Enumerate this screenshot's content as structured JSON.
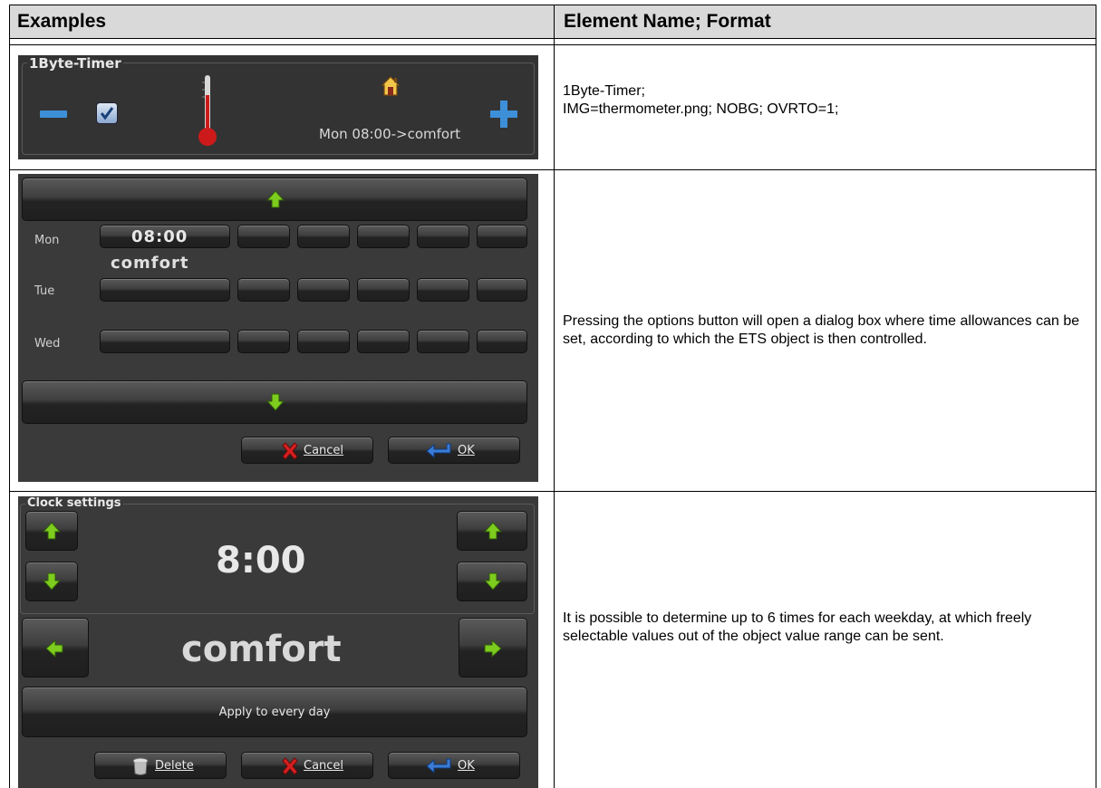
{
  "header": {
    "col_examples": "Examples",
    "col_element": "Element Name; Format"
  },
  "row1": {
    "desc_line1": "1Byte-Timer;",
    "desc_line2": "IMG=thermometer.png; NOBG; OVRTO=1;",
    "widget": {
      "title": "1Byte-Timer",
      "status": "Mon 08:00->comfort",
      "minus": "−",
      "plus": "+"
    }
  },
  "row2": {
    "desc": "Pressing the options button will open a dialog box where time allowances can be set, according to which the ETS object is then controlled.",
    "dialog": {
      "days": [
        "Mon",
        "Tue",
        "Wed"
      ],
      "mon_time": "08:00",
      "mon_mode": "comfort",
      "cancel": "Cancel",
      "ok": "OK"
    }
  },
  "row3": {
    "desc": "It is possible to determine up to 6 times for each weekday, at which freely selectable values out of the object value range can be sent.",
    "dialog": {
      "title": "Clock settings",
      "time": "8:00",
      "mode": "comfort",
      "apply": "Apply to every day",
      "delete": "Delete",
      "cancel": "Cancel",
      "ok": "OK"
    }
  },
  "colors": {
    "arrow_green": "#7dcc1e",
    "cross_red": "#d62020",
    "ok_blue": "#3a7bd5"
  }
}
